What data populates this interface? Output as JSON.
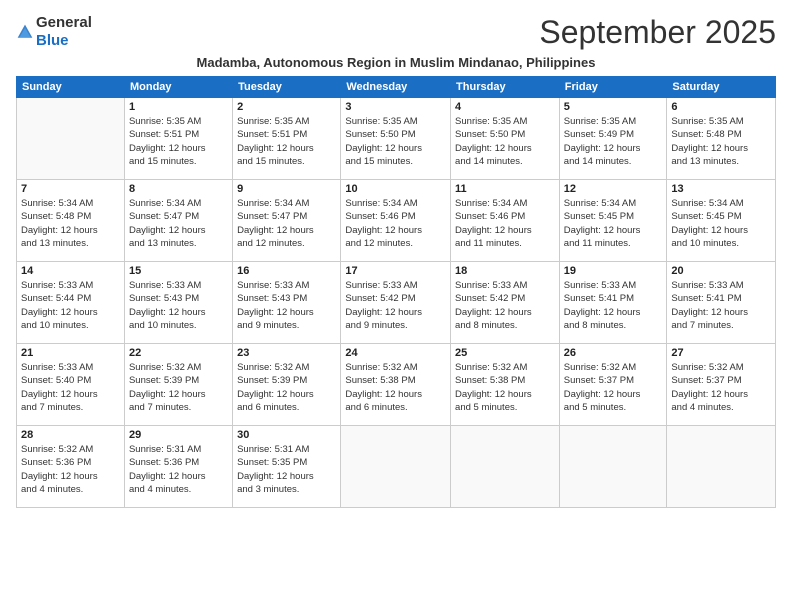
{
  "header": {
    "logo_general": "General",
    "logo_blue": "Blue",
    "month_title": "September 2025",
    "subtitle": "Madamba, Autonomous Region in Muslim Mindanao, Philippines"
  },
  "days_of_week": [
    "Sunday",
    "Monday",
    "Tuesday",
    "Wednesday",
    "Thursday",
    "Friday",
    "Saturday"
  ],
  "weeks": [
    [
      {
        "day": "",
        "lines": []
      },
      {
        "day": "1",
        "lines": [
          "Sunrise: 5:35 AM",
          "Sunset: 5:51 PM",
          "Daylight: 12 hours",
          "and 15 minutes."
        ]
      },
      {
        "day": "2",
        "lines": [
          "Sunrise: 5:35 AM",
          "Sunset: 5:51 PM",
          "Daylight: 12 hours",
          "and 15 minutes."
        ]
      },
      {
        "day": "3",
        "lines": [
          "Sunrise: 5:35 AM",
          "Sunset: 5:50 PM",
          "Daylight: 12 hours",
          "and 15 minutes."
        ]
      },
      {
        "day": "4",
        "lines": [
          "Sunrise: 5:35 AM",
          "Sunset: 5:50 PM",
          "Daylight: 12 hours",
          "and 14 minutes."
        ]
      },
      {
        "day": "5",
        "lines": [
          "Sunrise: 5:35 AM",
          "Sunset: 5:49 PM",
          "Daylight: 12 hours",
          "and 14 minutes."
        ]
      },
      {
        "day": "6",
        "lines": [
          "Sunrise: 5:35 AM",
          "Sunset: 5:48 PM",
          "Daylight: 12 hours",
          "and 13 minutes."
        ]
      }
    ],
    [
      {
        "day": "7",
        "lines": [
          "Sunrise: 5:34 AM",
          "Sunset: 5:48 PM",
          "Daylight: 12 hours",
          "and 13 minutes."
        ]
      },
      {
        "day": "8",
        "lines": [
          "Sunrise: 5:34 AM",
          "Sunset: 5:47 PM",
          "Daylight: 12 hours",
          "and 13 minutes."
        ]
      },
      {
        "day": "9",
        "lines": [
          "Sunrise: 5:34 AM",
          "Sunset: 5:47 PM",
          "Daylight: 12 hours",
          "and 12 minutes."
        ]
      },
      {
        "day": "10",
        "lines": [
          "Sunrise: 5:34 AM",
          "Sunset: 5:46 PM",
          "Daylight: 12 hours",
          "and 12 minutes."
        ]
      },
      {
        "day": "11",
        "lines": [
          "Sunrise: 5:34 AM",
          "Sunset: 5:46 PM",
          "Daylight: 12 hours",
          "and 11 minutes."
        ]
      },
      {
        "day": "12",
        "lines": [
          "Sunrise: 5:34 AM",
          "Sunset: 5:45 PM",
          "Daylight: 12 hours",
          "and 11 minutes."
        ]
      },
      {
        "day": "13",
        "lines": [
          "Sunrise: 5:34 AM",
          "Sunset: 5:45 PM",
          "Daylight: 12 hours",
          "and 10 minutes."
        ]
      }
    ],
    [
      {
        "day": "14",
        "lines": [
          "Sunrise: 5:33 AM",
          "Sunset: 5:44 PM",
          "Daylight: 12 hours",
          "and 10 minutes."
        ]
      },
      {
        "day": "15",
        "lines": [
          "Sunrise: 5:33 AM",
          "Sunset: 5:43 PM",
          "Daylight: 12 hours",
          "and 10 minutes."
        ]
      },
      {
        "day": "16",
        "lines": [
          "Sunrise: 5:33 AM",
          "Sunset: 5:43 PM",
          "Daylight: 12 hours",
          "and 9 minutes."
        ]
      },
      {
        "day": "17",
        "lines": [
          "Sunrise: 5:33 AM",
          "Sunset: 5:42 PM",
          "Daylight: 12 hours",
          "and 9 minutes."
        ]
      },
      {
        "day": "18",
        "lines": [
          "Sunrise: 5:33 AM",
          "Sunset: 5:42 PM",
          "Daylight: 12 hours",
          "and 8 minutes."
        ]
      },
      {
        "day": "19",
        "lines": [
          "Sunrise: 5:33 AM",
          "Sunset: 5:41 PM",
          "Daylight: 12 hours",
          "and 8 minutes."
        ]
      },
      {
        "day": "20",
        "lines": [
          "Sunrise: 5:33 AM",
          "Sunset: 5:41 PM",
          "Daylight: 12 hours",
          "and 7 minutes."
        ]
      }
    ],
    [
      {
        "day": "21",
        "lines": [
          "Sunrise: 5:33 AM",
          "Sunset: 5:40 PM",
          "Daylight: 12 hours",
          "and 7 minutes."
        ]
      },
      {
        "day": "22",
        "lines": [
          "Sunrise: 5:32 AM",
          "Sunset: 5:39 PM",
          "Daylight: 12 hours",
          "and 7 minutes."
        ]
      },
      {
        "day": "23",
        "lines": [
          "Sunrise: 5:32 AM",
          "Sunset: 5:39 PM",
          "Daylight: 12 hours",
          "and 6 minutes."
        ]
      },
      {
        "day": "24",
        "lines": [
          "Sunrise: 5:32 AM",
          "Sunset: 5:38 PM",
          "Daylight: 12 hours",
          "and 6 minutes."
        ]
      },
      {
        "day": "25",
        "lines": [
          "Sunrise: 5:32 AM",
          "Sunset: 5:38 PM",
          "Daylight: 12 hours",
          "and 5 minutes."
        ]
      },
      {
        "day": "26",
        "lines": [
          "Sunrise: 5:32 AM",
          "Sunset: 5:37 PM",
          "Daylight: 12 hours",
          "and 5 minutes."
        ]
      },
      {
        "day": "27",
        "lines": [
          "Sunrise: 5:32 AM",
          "Sunset: 5:37 PM",
          "Daylight: 12 hours",
          "and 4 minutes."
        ]
      }
    ],
    [
      {
        "day": "28",
        "lines": [
          "Sunrise: 5:32 AM",
          "Sunset: 5:36 PM",
          "Daylight: 12 hours",
          "and 4 minutes."
        ]
      },
      {
        "day": "29",
        "lines": [
          "Sunrise: 5:31 AM",
          "Sunset: 5:36 PM",
          "Daylight: 12 hours",
          "and 4 minutes."
        ]
      },
      {
        "day": "30",
        "lines": [
          "Sunrise: 5:31 AM",
          "Sunset: 5:35 PM",
          "Daylight: 12 hours",
          "and 3 minutes."
        ]
      },
      {
        "day": "",
        "lines": []
      },
      {
        "day": "",
        "lines": []
      },
      {
        "day": "",
        "lines": []
      },
      {
        "day": "",
        "lines": []
      }
    ]
  ]
}
